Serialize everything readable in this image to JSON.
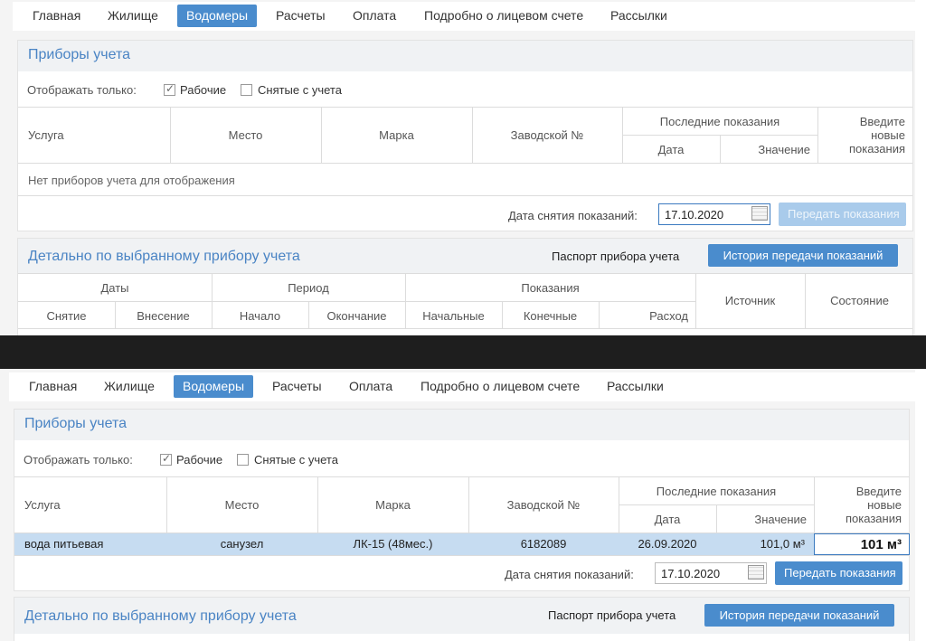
{
  "nav": {
    "items": [
      "Главная",
      "Жилище",
      "Водомеры",
      "Расчеты",
      "Оплата",
      "Подробно о лицевом счете",
      "Рассылки"
    ],
    "active": "Водомеры"
  },
  "meters_panel": {
    "title": "Приборы учета",
    "filter_label": "Отображать только:",
    "filter_working": "Рабочие",
    "filter_working_checked": true,
    "filter_removed": "Снятые с учета",
    "filter_removed_checked": false,
    "columns": {
      "service": "Услуга",
      "place": "Место",
      "brand": "Марка",
      "serial": "Заводской №",
      "last_readings": "Последние показания",
      "date": "Дата",
      "value": "Значение",
      "enter_new_1": "Введите",
      "enter_new_2": "новые",
      "enter_new_3": "показания"
    },
    "empty_text": "Нет приборов учета для отображения",
    "row": {
      "service": "вода питьевая",
      "place": "санузел",
      "brand": "ЛК-15 (48мес.)",
      "serial": "6182089",
      "date": "26.09.2020",
      "value": "101,0 м³",
      "new_reading": "101 м³"
    },
    "reading_date_label": "Дата снятия показаний:",
    "reading_date_value_1": "17.10.2020",
    "reading_date_value_2": "17.10.2020",
    "submit_label": "Передать показания"
  },
  "detail_panel": {
    "title": "Детально по выбранному прибору учета",
    "passport_link": "Паспорт прибора учета",
    "history_button": "История передачи показаний",
    "columns": {
      "dates": "Даты",
      "period": "Период",
      "readings": "Показания",
      "removal": "Снятие",
      "entry": "Внесение",
      "start": "Начало",
      "end": "Окончание",
      "initial": "Начальные",
      "final": "Конечные",
      "consumption": "Расход",
      "source": "Источник",
      "status": "Состояние"
    }
  },
  "colors": {
    "accent": "#4a8ccd",
    "title": "#4a84c4",
    "selected_row": "#c6dcf1",
    "disabled_button": "#a9cbeb"
  }
}
